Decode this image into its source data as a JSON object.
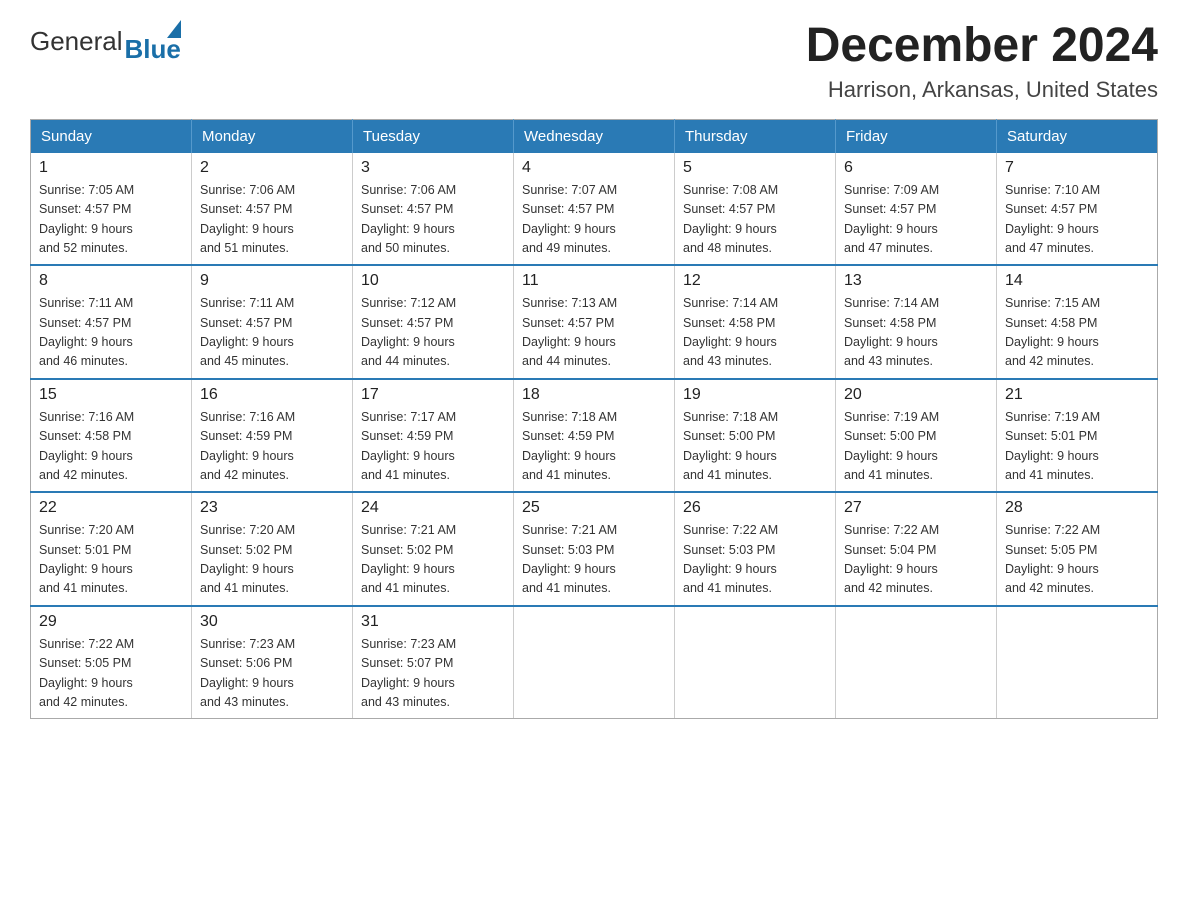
{
  "header": {
    "logo_general": "General",
    "logo_blue": "Blue",
    "month_title": "December 2024",
    "location": "Harrison, Arkansas, United States"
  },
  "days_of_week": [
    "Sunday",
    "Monday",
    "Tuesday",
    "Wednesday",
    "Thursday",
    "Friday",
    "Saturday"
  ],
  "weeks": [
    [
      {
        "day": "1",
        "sunrise": "7:05 AM",
        "sunset": "4:57 PM",
        "daylight": "9 hours and 52 minutes."
      },
      {
        "day": "2",
        "sunrise": "7:06 AM",
        "sunset": "4:57 PM",
        "daylight": "9 hours and 51 minutes."
      },
      {
        "day": "3",
        "sunrise": "7:06 AM",
        "sunset": "4:57 PM",
        "daylight": "9 hours and 50 minutes."
      },
      {
        "day": "4",
        "sunrise": "7:07 AM",
        "sunset": "4:57 PM",
        "daylight": "9 hours and 49 minutes."
      },
      {
        "day": "5",
        "sunrise": "7:08 AM",
        "sunset": "4:57 PM",
        "daylight": "9 hours and 48 minutes."
      },
      {
        "day": "6",
        "sunrise": "7:09 AM",
        "sunset": "4:57 PM",
        "daylight": "9 hours and 47 minutes."
      },
      {
        "day": "7",
        "sunrise": "7:10 AM",
        "sunset": "4:57 PM",
        "daylight": "9 hours and 47 minutes."
      }
    ],
    [
      {
        "day": "8",
        "sunrise": "7:11 AM",
        "sunset": "4:57 PM",
        "daylight": "9 hours and 46 minutes."
      },
      {
        "day": "9",
        "sunrise": "7:11 AM",
        "sunset": "4:57 PM",
        "daylight": "9 hours and 45 minutes."
      },
      {
        "day": "10",
        "sunrise": "7:12 AM",
        "sunset": "4:57 PM",
        "daylight": "9 hours and 44 minutes."
      },
      {
        "day": "11",
        "sunrise": "7:13 AM",
        "sunset": "4:57 PM",
        "daylight": "9 hours and 44 minutes."
      },
      {
        "day": "12",
        "sunrise": "7:14 AM",
        "sunset": "4:58 PM",
        "daylight": "9 hours and 43 minutes."
      },
      {
        "day": "13",
        "sunrise": "7:14 AM",
        "sunset": "4:58 PM",
        "daylight": "9 hours and 43 minutes."
      },
      {
        "day": "14",
        "sunrise": "7:15 AM",
        "sunset": "4:58 PM",
        "daylight": "9 hours and 42 minutes."
      }
    ],
    [
      {
        "day": "15",
        "sunrise": "7:16 AM",
        "sunset": "4:58 PM",
        "daylight": "9 hours and 42 minutes."
      },
      {
        "day": "16",
        "sunrise": "7:16 AM",
        "sunset": "4:59 PM",
        "daylight": "9 hours and 42 minutes."
      },
      {
        "day": "17",
        "sunrise": "7:17 AM",
        "sunset": "4:59 PM",
        "daylight": "9 hours and 41 minutes."
      },
      {
        "day": "18",
        "sunrise": "7:18 AM",
        "sunset": "4:59 PM",
        "daylight": "9 hours and 41 minutes."
      },
      {
        "day": "19",
        "sunrise": "7:18 AM",
        "sunset": "5:00 PM",
        "daylight": "9 hours and 41 minutes."
      },
      {
        "day": "20",
        "sunrise": "7:19 AM",
        "sunset": "5:00 PM",
        "daylight": "9 hours and 41 minutes."
      },
      {
        "day": "21",
        "sunrise": "7:19 AM",
        "sunset": "5:01 PM",
        "daylight": "9 hours and 41 minutes."
      }
    ],
    [
      {
        "day": "22",
        "sunrise": "7:20 AM",
        "sunset": "5:01 PM",
        "daylight": "9 hours and 41 minutes."
      },
      {
        "day": "23",
        "sunrise": "7:20 AM",
        "sunset": "5:02 PM",
        "daylight": "9 hours and 41 minutes."
      },
      {
        "day": "24",
        "sunrise": "7:21 AM",
        "sunset": "5:02 PM",
        "daylight": "9 hours and 41 minutes."
      },
      {
        "day": "25",
        "sunrise": "7:21 AM",
        "sunset": "5:03 PM",
        "daylight": "9 hours and 41 minutes."
      },
      {
        "day": "26",
        "sunrise": "7:22 AM",
        "sunset": "5:03 PM",
        "daylight": "9 hours and 41 minutes."
      },
      {
        "day": "27",
        "sunrise": "7:22 AM",
        "sunset": "5:04 PM",
        "daylight": "9 hours and 42 minutes."
      },
      {
        "day": "28",
        "sunrise": "7:22 AM",
        "sunset": "5:05 PM",
        "daylight": "9 hours and 42 minutes."
      }
    ],
    [
      {
        "day": "29",
        "sunrise": "7:22 AM",
        "sunset": "5:05 PM",
        "daylight": "9 hours and 42 minutes."
      },
      {
        "day": "30",
        "sunrise": "7:23 AM",
        "sunset": "5:06 PM",
        "daylight": "9 hours and 43 minutes."
      },
      {
        "day": "31",
        "sunrise": "7:23 AM",
        "sunset": "5:07 PM",
        "daylight": "9 hours and 43 minutes."
      },
      null,
      null,
      null,
      null
    ]
  ],
  "labels": {
    "sunrise_prefix": "Sunrise: ",
    "sunset_prefix": "Sunset: ",
    "daylight_prefix": "Daylight: "
  }
}
